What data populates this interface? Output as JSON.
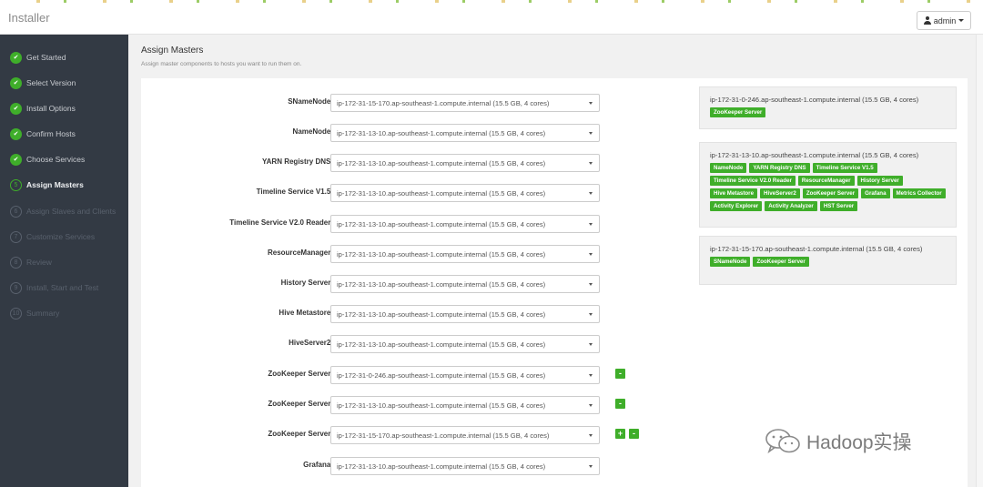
{
  "header": {
    "app_title": "Installer",
    "user_label": "admin",
    "user_icon": "user-icon"
  },
  "sidebar": {
    "steps": [
      {
        "marker": "✔",
        "label": "Get Started",
        "state": "done"
      },
      {
        "marker": "✔",
        "label": "Select Version",
        "state": "done"
      },
      {
        "marker": "✔",
        "label": "Install Options",
        "state": "done"
      },
      {
        "marker": "✔",
        "label": "Confirm Hosts",
        "state": "done"
      },
      {
        "marker": "✔",
        "label": "Choose Services",
        "state": "done"
      },
      {
        "marker": "5",
        "label": "Assign Masters",
        "state": "active"
      },
      {
        "marker": "6",
        "label": "Assign Slaves and Clients",
        "state": "todo"
      },
      {
        "marker": "7",
        "label": "Customize Services",
        "state": "todo"
      },
      {
        "marker": "8",
        "label": "Review",
        "state": "todo"
      },
      {
        "marker": "9",
        "label": "Install, Start and Test",
        "state": "todo"
      },
      {
        "marker": "10",
        "label": "Summary",
        "state": "todo"
      }
    ]
  },
  "page": {
    "title": "Assign Masters",
    "subtitle": "Assign master components to hosts you want to run them on."
  },
  "assignments": [
    {
      "label": "SNameNode:",
      "host": "ip-172-31-15-170.ap-southeast-1.compute.internal (15.5 GB, 4 cores)"
    },
    {
      "label": "NameNode:",
      "host": "ip-172-31-13-10.ap-southeast-1.compute.internal (15.5 GB, 4 cores)"
    },
    {
      "label": "YARN Registry DNS:",
      "host": "ip-172-31-13-10.ap-southeast-1.compute.internal (15.5 GB, 4 cores)"
    },
    {
      "label": "Timeline Service V1.5:",
      "host": "ip-172-31-13-10.ap-southeast-1.compute.internal (15.5 GB, 4 cores)"
    },
    {
      "label": "Timeline Service V2.0 Reader:",
      "host": "ip-172-31-13-10.ap-southeast-1.compute.internal (15.5 GB, 4 cores)"
    },
    {
      "label": "ResourceManager:",
      "host": "ip-172-31-13-10.ap-southeast-1.compute.internal (15.5 GB, 4 cores)"
    },
    {
      "label": "History Server:",
      "host": "ip-172-31-13-10.ap-southeast-1.compute.internal (15.5 GB, 4 cores)"
    },
    {
      "label": "Hive Metastore:",
      "host": "ip-172-31-13-10.ap-southeast-1.compute.internal (15.5 GB, 4 cores)"
    },
    {
      "label": "HiveServer2:",
      "host": "ip-172-31-13-10.ap-southeast-1.compute.internal (15.5 GB, 4 cores)"
    },
    {
      "label": "ZooKeeper Server:",
      "host": "ip-172-31-0-246.ap-southeast-1.compute.internal (15.5 GB, 4 cores)",
      "buttons": [
        "-"
      ]
    },
    {
      "label": "ZooKeeper Server:",
      "host": "ip-172-31-13-10.ap-southeast-1.compute.internal (15.5 GB, 4 cores)",
      "buttons": [
        "-"
      ]
    },
    {
      "label": "ZooKeeper Server:",
      "host": "ip-172-31-15-170.ap-southeast-1.compute.internal (15.5 GB, 4 cores)",
      "buttons": [
        "+",
        "-"
      ]
    },
    {
      "label": "Grafana:",
      "host": "ip-172-31-13-10.ap-southeast-1.compute.internal (15.5 GB, 4 cores)"
    }
  ],
  "host_summary": [
    {
      "host": "ip-172-31-0-246.ap-southeast-1.compute.internal (15.5 GB, 4 cores)",
      "components": [
        "ZooKeeper Server"
      ]
    },
    {
      "host": "ip-172-31-13-10.ap-southeast-1.compute.internal (15.5 GB, 4 cores)",
      "components": [
        "NameNode",
        "YARN Registry DNS",
        "Timeline Service V1.5",
        "Timeline Service V2.0 Reader",
        "ResourceManager",
        "History Server",
        "Hive Metastore",
        "HiveServer2",
        "ZooKeeper Server",
        "Grafana",
        "Metrics Collector",
        "Activity Explorer",
        "Activity Analyzer",
        "HST Server"
      ]
    },
    {
      "host": "ip-172-31-15-170.ap-southeast-1.compute.internal (15.5 GB, 4 cores)",
      "components": [
        "SNameNode",
        "ZooKeeper Server"
      ]
    }
  ],
  "watermark": {
    "text": "Hadoop实操",
    "icon": "chat-bubbles-icon"
  },
  "colors": {
    "accent_green": "#3fae2a",
    "sidebar_bg": "#333a44"
  }
}
